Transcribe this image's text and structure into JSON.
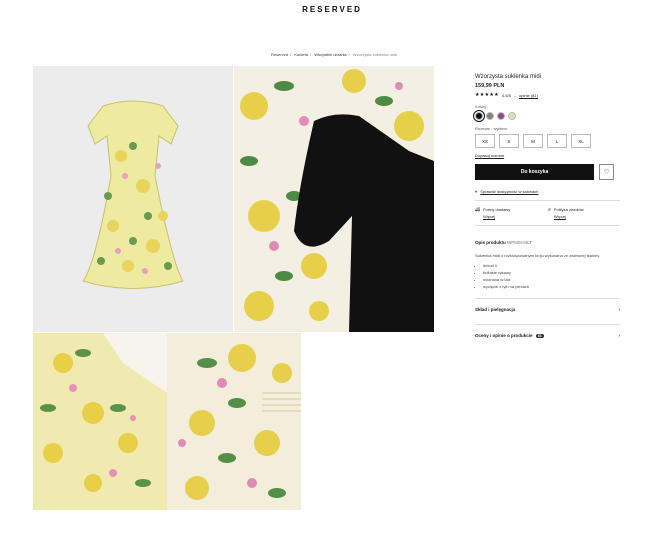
{
  "header": {
    "logo": "RESERVED"
  },
  "breadcrumb": [
    "Reserved",
    "Kobieta",
    "Wszystkie ubrania",
    "Wzorzysta sukienka midi"
  ],
  "product": {
    "title": "Wzorzysta sukienka midi",
    "price": "159,99 PLN",
    "stars": "★★★★★",
    "rating": "4.5/5",
    "rating_sep": "–",
    "reviews": "opinie (81)",
    "color_label": "Kolory",
    "colors": [
      "#111111",
      "#8c7b70",
      "#8a4a8c",
      "#dfe0b0"
    ],
    "size_label": "Rozmiar - wybierz",
    "sizes": [
      "XS",
      "S",
      "M",
      "L",
      "XL"
    ],
    "size_guide": "Dopasuj rozmiar",
    "add_to_cart": "Do koszyka",
    "wishlist_icon": "heart-icon",
    "availability": "Sprawdź dostępność w salonach",
    "delivery": {
      "title": "Formy dostawy",
      "link": "Więcej"
    },
    "returns": {
      "title": "Polityka zwrotów",
      "link": "Więcej"
    },
    "description_title": "Opis produktu",
    "description_code": "WP608-MLT",
    "description": "Sukienka midi o rozkloszowanym kroju wykonana ze zwiewnej tkaniny.",
    "bullets": [
      "dekolt V",
      "bufiaste rękawy",
      "odcinana w talii",
      "wycięcie z tyłu na plecach"
    ],
    "care_label": "Skład i pielęgnacja",
    "reviews_label": "Oceny i opinie o produkcie",
    "reviews_badge": "81"
  },
  "gallery": [
    "dress-front-photo",
    "dress-black-detail-photo",
    "dress-detail-photo",
    "sleeve-detail-photo"
  ]
}
